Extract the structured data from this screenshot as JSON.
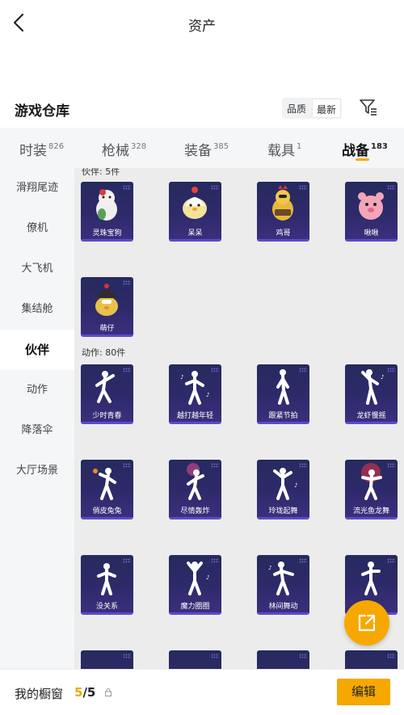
{
  "header": {
    "title": "资产"
  },
  "warehouse": {
    "title": "游戏仓库",
    "sort_options": [
      "品质",
      "最新"
    ],
    "sort_selected": "最新"
  },
  "tabs": [
    {
      "label": "时装",
      "count": "826"
    },
    {
      "label": "枪械",
      "count": "328"
    },
    {
      "label": "装备",
      "count": "385"
    },
    {
      "label": "载具",
      "count": "1"
    },
    {
      "label": "战备",
      "count": "183",
      "active": true
    }
  ],
  "sidebar": {
    "items": [
      "滑翔尾迹",
      "僚机",
      "大飞机",
      "集结舱",
      "伙伴",
      "动作",
      "降落伞",
      "大厅场景"
    ],
    "active": "伙伴"
  },
  "sections": {
    "partners": {
      "label": "伙伴: 5件",
      "items": [
        "灵珠宝狗",
        "呆呆",
        "鸡哥",
        "啾啾",
        "萌仔"
      ]
    },
    "actions": {
      "label": "动作: 80件",
      "items": [
        "少时青春",
        "越打越年轻",
        "跟紧节拍",
        "龙虾慢摇",
        "俏皮兔兔",
        "尽情轰炸",
        "玲珑起舞",
        "流光鱼龙舞",
        "没关系",
        "魔力圈圈",
        "林间舞动",
        ""
      ]
    }
  },
  "bottom": {
    "my_window": "我的橱窗",
    "current": "5",
    "separator": "/",
    "total": "5",
    "edit_label": "编辑"
  },
  "colors": {
    "accent": "#f7a800",
    "card_bg": "#2e2a6a",
    "panel_bg": "#ececec"
  },
  "icons": [
    "back-arrow-icon",
    "filter-icon",
    "lock-icon",
    "share-external-icon"
  ]
}
